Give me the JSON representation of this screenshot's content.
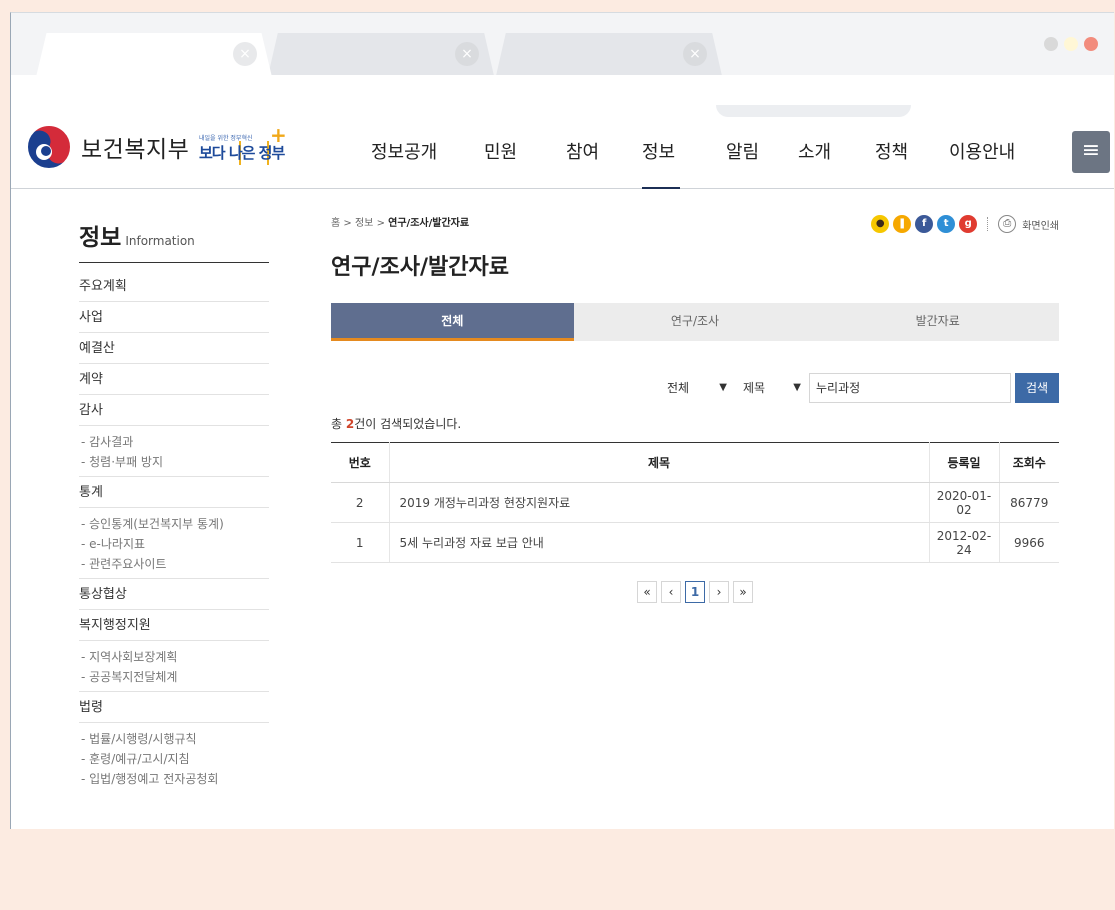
{
  "browser": {
    "tabs": [
      {
        "close": "×"
      },
      {
        "close": "×"
      },
      {
        "close": "×"
      }
    ],
    "window_dots": [
      "#d9d9d9",
      "#fff7d6",
      "#f28c7d"
    ]
  },
  "header": {
    "logo_name": "보건복지부",
    "slogan_small": "내일을 위한 정부혁신",
    "slogan_big": "보다 나은 정부",
    "nav": [
      "정보공개",
      "민원",
      "참여",
      "정보",
      "알림",
      "소개",
      "정책",
      "이용안내"
    ],
    "menu_icon": "≡"
  },
  "sidebar": {
    "title": "정보",
    "title_en": "Information",
    "items": [
      {
        "label": "주요계획"
      },
      {
        "label": "사업"
      },
      {
        "label": "예결산"
      },
      {
        "label": "계약"
      },
      {
        "label": "감사",
        "subs": [
          "- 감사결과",
          "- 청렴·부패 방지"
        ]
      },
      {
        "label": "통계",
        "subs": [
          "- 승인통계(보건복지부 통계)",
          "- e-나라지표",
          "- 관련주요사이트"
        ]
      },
      {
        "label": "통상협상"
      },
      {
        "label": "복지행정지원",
        "subs": [
          "- 지역사회보장계획",
          "- 공공복지전달체계"
        ]
      },
      {
        "label": "법령",
        "subs": [
          "- 법률/시행령/시행규칙",
          "- 훈령/예규/고시/지침",
          "- 입법/행정예고 전자공청회"
        ]
      }
    ]
  },
  "content": {
    "breadcrumb": {
      "home": "홈",
      "sep": ">",
      "level1": "정보",
      "current": "연구/조사/발간자료"
    },
    "share": {
      "print_label": "화면인쇄"
    },
    "page_title": "연구/조사/발간자료",
    "tabs": [
      "전체",
      "연구/조사",
      "발간자료"
    ],
    "search": {
      "scope_value": "전체",
      "field_value": "제목",
      "query": "누리과정",
      "button": "검색"
    },
    "result": {
      "prefix": "총 ",
      "count": "2",
      "suffix": "건이 검색되었습니다."
    },
    "table": {
      "headers": [
        "번호",
        "제목",
        "등록일",
        "조회수"
      ],
      "rows": [
        {
          "no": "2",
          "title": "2019 개정누리과정 현장지원자료",
          "date": "2020-01-02",
          "views": "86779"
        },
        {
          "no": "1",
          "title": "5세 누리과정 자료 보급 안내",
          "date": "2012-02-24",
          "views": "9966"
        }
      ]
    },
    "pager": {
      "first": "«",
      "prev": "‹",
      "page": "1",
      "next": "›",
      "last": "»"
    }
  },
  "colors": {
    "page_bg": "#fcebe1",
    "active_tab": "#5f6e8f",
    "tab_underline": "#e58a1f",
    "search_button": "#3d6aa6",
    "result_count": "#d0452b"
  }
}
